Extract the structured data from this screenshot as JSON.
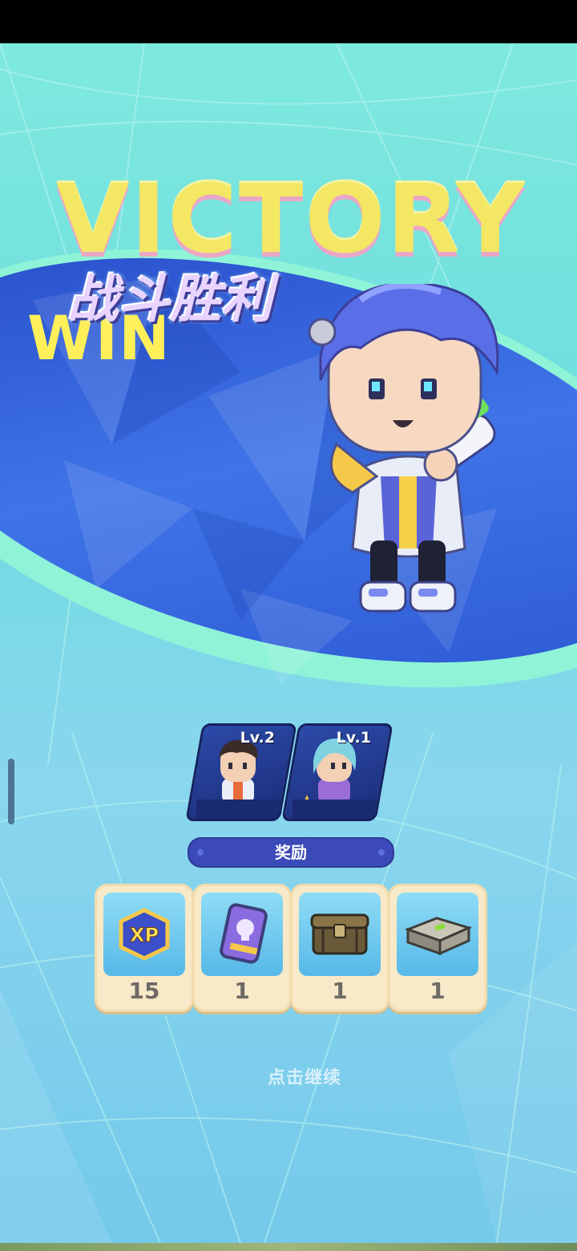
{
  "banner": {
    "victory_word": "VICTORY",
    "win_word": "WIN",
    "title": "战斗胜利"
  },
  "team": [
    {
      "level_label": "Lv.2",
      "icon": "boy-hero-portrait"
    },
    {
      "level_label": "Lv.1",
      "icon": "girl-hero-portrait"
    }
  ],
  "rewards": {
    "header": "奖励",
    "items": [
      {
        "icon": "xp-badge-icon",
        "quantity": "15"
      },
      {
        "icon": "skull-card-icon",
        "quantity": "1"
      },
      {
        "icon": "wooden-chest-icon",
        "quantity": "1"
      },
      {
        "icon": "metal-case-icon",
        "quantity": "1"
      }
    ]
  },
  "continue_hint": "点击继续",
  "colors": {
    "background": "#7ee9de",
    "stage": "#2f57d6",
    "reward_header": "#3b4ab8",
    "reward_card": "#f8e9c8"
  }
}
